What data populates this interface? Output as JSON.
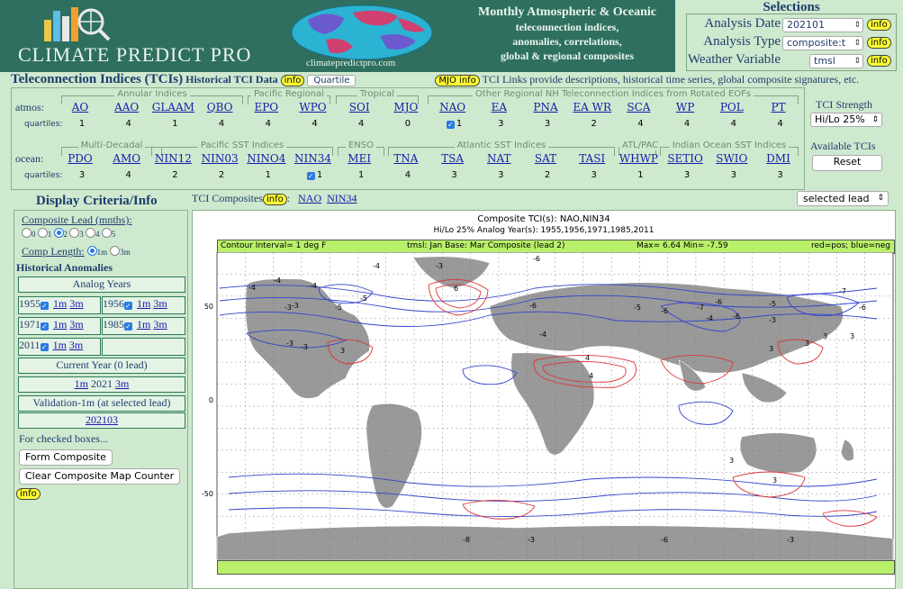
{
  "header": {
    "logo_text": "CLIMATE PREDICT PRO",
    "site_url": "climatepredictpro.com",
    "desc_line1": "Monthly Atmospheric & Oceanic",
    "desc_line2": "teleconnection indices,",
    "desc_line3": "anomalies, correlations,",
    "desc_line4": "global & regional composites"
  },
  "selections": {
    "title": "Selections",
    "analysis_date_label": "Analysis Date",
    "analysis_date_value": "202101",
    "analysis_type_label": "Analysis Type",
    "analysis_type_value": "composite:t",
    "weather_variable_label": "Weather Variable",
    "weather_variable_value": "tmsl",
    "info": "info"
  },
  "tci_header": {
    "title": "Teleconnection Indices (TCIs)",
    "historical": "Historical TCI Data",
    "info": "info",
    "quartile": "Quartile",
    "mjo_info": "MJO info",
    "links_text": "TCI Links provide descriptions, historical time series, global composite signatures, etc."
  },
  "atmos": {
    "row_label": "atmos:",
    "quart_label": "quartiles:",
    "groups": [
      "Annular Indices",
      "Pacific Regional",
      "Tropical",
      "Other Regional NH Teleconnection Indices from Rotated EOFs"
    ],
    "indices": [
      {
        "name": "AO",
        "q": "1",
        "checked": false
      },
      {
        "name": "AAO",
        "q": "4",
        "checked": false
      },
      {
        "name": "GLAAM",
        "q": "1",
        "checked": false
      },
      {
        "name": "QBO",
        "q": "4",
        "checked": false
      },
      {
        "name": "EPO",
        "q": "4",
        "checked": false
      },
      {
        "name": "WPO",
        "q": "4",
        "checked": false
      },
      {
        "name": "SOI",
        "q": "4",
        "checked": false
      },
      {
        "name": "MJO",
        "q": "0",
        "checked": false
      },
      {
        "name": "NAO",
        "q": "1",
        "checked": true
      },
      {
        "name": "EA",
        "q": "3",
        "checked": false
      },
      {
        "name": "PNA",
        "q": "3",
        "checked": false
      },
      {
        "name": "EA_WR",
        "q": "2",
        "checked": false
      },
      {
        "name": "SCA",
        "q": "4",
        "checked": false
      },
      {
        "name": "WP",
        "q": "4",
        "checked": false
      },
      {
        "name": "POL",
        "q": "4",
        "checked": false
      },
      {
        "name": "PT",
        "q": "4",
        "checked": false
      }
    ]
  },
  "ocean": {
    "row_label": "ocean:",
    "quart_label": "quartiles:",
    "groups": [
      "Multi-Decadal",
      "Pacific SST Indices",
      "ENSO",
      "Atlantic SST Indices",
      "ATL/PAC",
      "Indian Ocean SST Indices"
    ],
    "indices": [
      {
        "name": "PDO",
        "q": "3",
        "checked": false
      },
      {
        "name": "AMO",
        "q": "4",
        "checked": false
      },
      {
        "name": "NIN12",
        "q": "2",
        "checked": false
      },
      {
        "name": "NIN03",
        "q": "2",
        "checked": false
      },
      {
        "name": "NINO4",
        "q": "1",
        "checked": false
      },
      {
        "name": "NIN34",
        "q": "1",
        "checked": true
      },
      {
        "name": "MEI",
        "q": "1",
        "checked": false
      },
      {
        "name": "TNA",
        "q": "4",
        "checked": false
      },
      {
        "name": "TSA",
        "q": "3",
        "checked": false
      },
      {
        "name": "NAT",
        "q": "3",
        "checked": false
      },
      {
        "name": "SAT",
        "q": "2",
        "checked": false
      },
      {
        "name": "TASI",
        "q": "3",
        "checked": false
      },
      {
        "name": "WHWP",
        "q": "1",
        "checked": false
      },
      {
        "name": "SETIO",
        "q": "3",
        "checked": false
      },
      {
        "name": "SWIO",
        "q": "3",
        "checked": false
      },
      {
        "name": "DMI",
        "q": "3",
        "checked": false
      }
    ]
  },
  "strength": {
    "title": "TCI Strength",
    "value": "Hi/Lo 25%",
    "available": "Available TCIs",
    "reset": "Reset"
  },
  "left": {
    "title": "Display Criteria/Info",
    "lead_label": "Composite Lead (mnths):",
    "lead_options": [
      "0",
      "1",
      "2",
      "3",
      "4",
      "5"
    ],
    "lead_selected": "2",
    "comp_length_label": "Comp Length:",
    "comp_length_options": [
      "1m",
      "3m"
    ],
    "hist_anom": "Historical Anomalies",
    "analog_years_label": "Analog Years",
    "years": [
      "1955",
      "1956",
      "1971",
      "1985",
      "2011"
    ],
    "link_1m": "1m",
    "link_3m": "3m",
    "current_year_label": "Current Year (0 lead)",
    "current_year": "2021",
    "validation_label": "Validation-1m (at selected lead)",
    "validation_value": "202103",
    "checked_text": "For checked boxes...",
    "form_composite": "Form Composite",
    "clear_counter": "Clear Composite Map Counter",
    "info": "info"
  },
  "composite": {
    "label": "TCI Composites",
    "info": "info",
    "links": [
      "NAO",
      "NIN34"
    ],
    "lead_select": "selected lead"
  },
  "map": {
    "title": "Composite TCI(s): NAO,NIN34",
    "subtitle": "Hi/Lo 25% Analog Year(s): 1955,1956,1971,1985,2011",
    "band_left": "Contour Interval= 1 deg F",
    "band_mid": "tmsl:  Jan Base:  Mar Composite (lead 2)",
    "band_stats": "Max= 6.64  Min= -7.59",
    "band_right": "red=pos; blue=neg",
    "lat_labels": [
      "50",
      "0",
      "-50"
    ],
    "contour_labels_blue": [
      "-4",
      "-4",
      "-4",
      "-3",
      "-4",
      "-5",
      "-5",
      "-6",
      "-6",
      "-7",
      "-5",
      "-6",
      "-7",
      "-6",
      "-6",
      "-5",
      "-4",
      "-3",
      "-3",
      "-3",
      "-6",
      "-8",
      "-6",
      "-3",
      "-3",
      "-4",
      "-3"
    ],
    "contour_labels_red": [
      "-3",
      "6",
      "4",
      "3",
      "3",
      "3",
      "3",
      "4",
      "3",
      "3",
      "3"
    ],
    "colors": {
      "pos": "#d33",
      "neg": "#3344cc",
      "land": "#999999"
    }
  }
}
